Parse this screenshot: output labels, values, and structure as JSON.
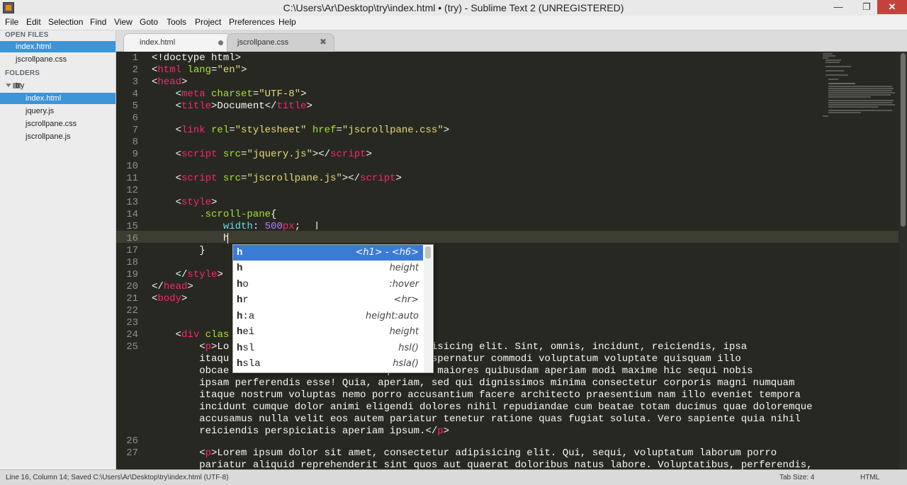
{
  "window": {
    "title": "C:\\Users\\Ar\\Desktop\\try\\index.html • (try) - Sublime Text 2 (UNREGISTERED)",
    "min_glyph": "—",
    "max_glyph": "❐",
    "close_glyph": "✕"
  },
  "menu": [
    "File",
    "Edit",
    "Selection",
    "Find",
    "View",
    "Goto",
    "Tools",
    "Project",
    "Preferences",
    "Help"
  ],
  "sidebar": {
    "open_files_header": "OPEN FILES",
    "open_files": [
      "index.html",
      "jscrollpane.css"
    ],
    "folders_header": "FOLDERS",
    "folder_name": "try",
    "folder_files": [
      "index.html",
      "jquery.js",
      "jscrollpane.css",
      "jscrollpane.js"
    ]
  },
  "tabs": [
    {
      "label": "index.html",
      "state": "active",
      "marker": "dirty"
    },
    {
      "label": "jscrollpane.css",
      "state": "inactive",
      "marker": "close",
      "close_glyph": "✖"
    }
  ],
  "editor": {
    "line_numbers": [
      "1",
      "2",
      "3",
      "4",
      "5",
      "6",
      "7",
      "8",
      "9",
      "10",
      "11",
      "12",
      "13",
      "14",
      "15",
      "16",
      "17",
      "18",
      "19",
      "20",
      "21",
      "22",
      "23",
      "24",
      "25",
      "26",
      "27"
    ],
    "lines": {
      "l1": "<!doctype html>",
      "l2a": "<",
      "l2b": "html",
      "l2c": " lang",
      "l2d": "=",
      "l2e": "\"en\"",
      "l2f": ">",
      "l3a": "<",
      "l3b": "head",
      "l3c": ">",
      "l4a": "    <",
      "l4b": "meta",
      "l4c": " charset",
      "l4d": "=",
      "l4e": "\"UTF-8\"",
      "l4f": ">",
      "l5a": "    <",
      "l5b": "title",
      "l5c": ">Document</",
      "l5d": "title",
      "l5e": ">",
      "l7a": "    <",
      "l7b": "link",
      "l7c": " rel",
      "l7d": "=",
      "l7e": "\"stylesheet\"",
      "l7f": " href",
      "l7g": "=",
      "l7h": "\"jscrollpane.css\"",
      "l7i": ">",
      "l9a": "    <",
      "l9b": "script",
      "l9c": " src",
      "l9d": "=",
      "l9e": "\"jquery.js\"",
      "l9f": "></",
      "l9g": "script",
      "l9h": ">",
      "l11a": "    <",
      "l11b": "script",
      "l11c": " src",
      "l11d": "=",
      "l11e": "\"jscrollpane.js\"",
      "l11f": "></",
      "l11g": "script",
      "l11h": ">",
      "l13a": "    <",
      "l13b": "style",
      "l13c": ">",
      "l14a": "        ",
      "l14b": ".scroll-pane",
      "l14c": "{",
      "l15a": "            ",
      "l15b": "width",
      "l15c": ": ",
      "l15d": "500",
      "l15e": "px",
      "l15f": ";",
      "l16": "            h",
      "l17": "        }",
      "l19a": "    </",
      "l19b": "style",
      "l19c": ">",
      "l20a": "</",
      "l20b": "head",
      "l20c": ">",
      "l21a": "<",
      "l21b": "body",
      "l21c": ">",
      "l24a": "    <",
      "l24b": "div",
      "l24c": " clas",
      "l25a1": "        <",
      "l25a2": "p",
      "l25a3": ">Lo",
      "l25a4": "                          tur adipisicing elit. Sint, omnis, incidunt, reiciendis, ipsa",
      "l25b": "        itaqu                          luptas aspernatur commodi voluptatum voluptate quisquam illo",
      "l25c": "        obcae                          que amet maiores quibusdam aperiam modi maxime hic sequi nobis",
      "l25d": "        ipsam perferendis esse! Quia, aperiam, sed qui dignissimos minima consectetur corporis magni numquam",
      "l25e": "        itaque nostrum voluptas nemo porro accusantium facere architecto praesentium nam illo eveniet tempora",
      "l25f": "        incidunt cumque dolor animi eligendi dolores nihil repudiandae cum beatae totam ducimus quae doloremque",
      "l25g": "        accusamus nulla velit eos autem pariatur tenetur ratione quas fugiat soluta. Vero sapiente quia nihil",
      "l25h1": "        reiciendis perspiciatis aperiam ipsum.</",
      "l25h2": "p",
      "l25h3": ">",
      "l27a1": "        <",
      "l27a2": "p",
      "l27a3": ">Lorem ipsum dolor sit amet, consectetur adipisicing elit. Qui, sequi, voluptatum laborum porro",
      "l27b": "        pariatur aliquid reprehenderit sint quos aut quaerat doloribus natus labore. Voluptatibus, perferendis,"
    }
  },
  "autocomplete": {
    "items": [
      {
        "bold": "h",
        "rest": "",
        "hint": "<h1> - <h6>",
        "selected": true
      },
      {
        "bold": "h",
        "rest": "",
        "hint": "height",
        "selected": false
      },
      {
        "bold": "h",
        "rest": "o",
        "hint": ":hover",
        "selected": false
      },
      {
        "bold": "h",
        "rest": "r",
        "hint": "<hr>",
        "selected": false
      },
      {
        "bold": "h",
        "rest": ":a",
        "hint": "height:auto",
        "selected": false
      },
      {
        "bold": "h",
        "rest": "ei",
        "hint": "height",
        "selected": false
      },
      {
        "bold": "h",
        "rest": "sl",
        "hint": "hsl()",
        "selected": false
      },
      {
        "bold": "h",
        "rest": "sla",
        "hint": "hsla()",
        "selected": false
      }
    ]
  },
  "status": {
    "left": "Line 16, Column 14; Saved C:\\Users\\Ar\\Desktop\\try\\index.html (UTF-8)",
    "tab_size": "Tab Size: 4",
    "syntax": "HTML"
  },
  "colors": {
    "editor_bg": "#272822",
    "tag": "#f92672",
    "attribute": "#a6e22e",
    "string": "#e6db74",
    "number": "#ae81ff",
    "property": "#66d9ef",
    "selection_blue": "#3d94d6"
  }
}
